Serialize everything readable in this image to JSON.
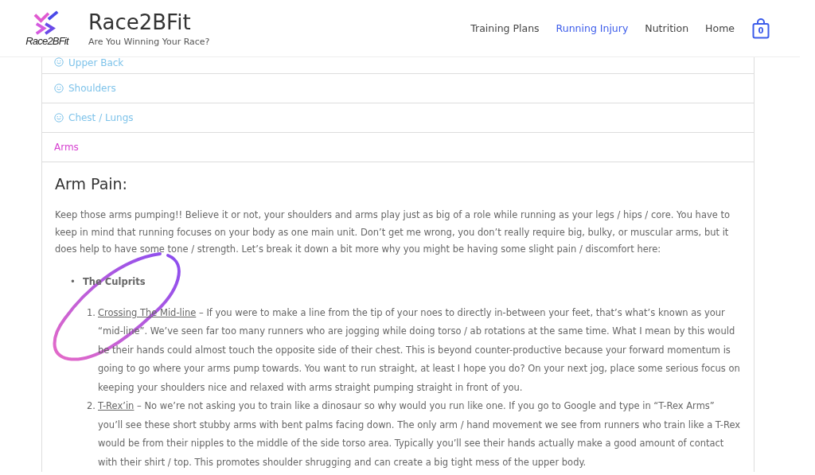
{
  "header": {
    "logo_caption": "Race2BFit",
    "title": "Race2BFit",
    "tagline": "Are You Winning Your Race?",
    "nav": [
      {
        "label": "Training Plans",
        "selected": false
      },
      {
        "label": "Running Injury",
        "selected": true
      },
      {
        "label": "Nutrition",
        "selected": false
      },
      {
        "label": "Home",
        "selected": false
      }
    ],
    "cart_count": "0"
  },
  "accordion": [
    {
      "label": "Upper Back",
      "selected": false
    },
    {
      "label": "Shoulders",
      "selected": false
    },
    {
      "label": "Chest / Lungs",
      "selected": false
    },
    {
      "label": "Arms",
      "selected": true
    }
  ],
  "article": {
    "heading": "Arm Pain:",
    "intro": "Keep those arms pumping!! Believe it or not, your shoulders and arms play just as big of a role while running as your legs / hips / core. You have to keep in mind that running focuses on your body as one main unit. Don’t get me wrong, you don’t really require big, bulky, or muscular arms, but it does help to have some tone / strength. Let’s break it down a bit more why you might be having some slight pain / discomfort here:",
    "bullet": {
      "marker": "•",
      "text": "The Culprits"
    },
    "culprits": [
      {
        "marker": "1.",
        "term": "Crossing The Mid-line",
        "text": " – If you were to make a line from the tip of your noes to directly in-between your feet, that’s what’s known as your “mid-line”. We’ve seen far too many runners who are jogging while doing torso / ab rotations at the same time. What I mean by this would be their hands could almost touch the opposite side of their chest. This is beyond counter-productive because your forward momentum is going to go where your arms pump towards. You want to run straight, at least I hope you do? On your next jog, place some serious focus on keeping your shoulders nice and relaxed with arms straight pumping straight in front of you."
      },
      {
        "marker": "2.",
        "term": "T-Rex’in",
        "text": " – No we’re not asking you to train like a dinosaur so why would you run like one. If you go to Google and type in “T-Rex Arms” you’ll see these short stubby arms with bent palms facing down. The only arm / hand movement we see from runners who train like a T-Rex would be from their nipples to the middle of the side torso area. Typically you’ll see their hands actually make a good amount of contact with their shirt / top. This promotes shoulder shrugging and can create a big tight mess of the upper body."
      }
    ]
  }
}
